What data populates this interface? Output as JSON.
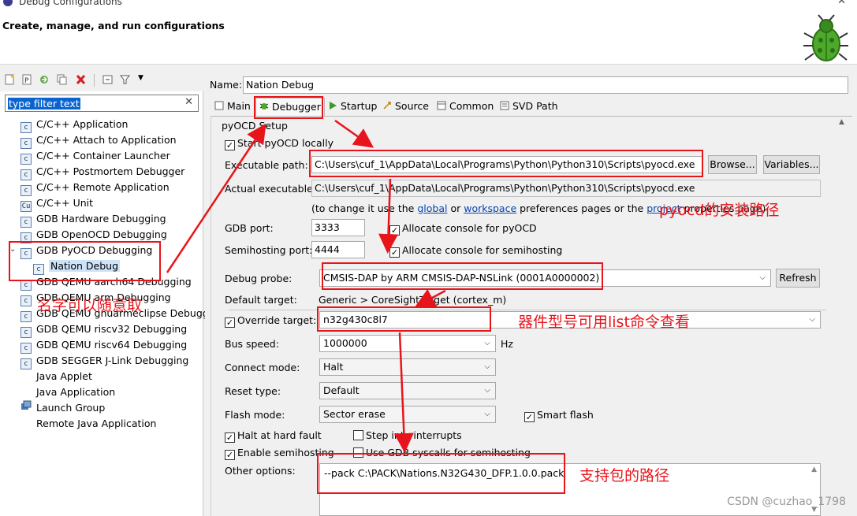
{
  "window": {
    "title": "Debug Configurations"
  },
  "header": {
    "heading": "Create, manage, and run configurations"
  },
  "left": {
    "filter_placeholder": "type filter text",
    "items": [
      {
        "label": "C/C++ Application",
        "icon": "c-config-icon"
      },
      {
        "label": "C/C++ Attach to Application",
        "icon": "c-config-icon"
      },
      {
        "label": "C/C++ Container Launcher",
        "icon": "c-config-icon"
      },
      {
        "label": "C/C++ Postmortem Debugger",
        "icon": "c-config-icon"
      },
      {
        "label": "C/C++ Remote Application",
        "icon": "c-config-icon"
      },
      {
        "label": "C/C++ Unit",
        "icon": "c-unit-icon"
      },
      {
        "label": "GDB Hardware Debugging",
        "icon": "c-config-icon"
      },
      {
        "label": "GDB OpenOCD Debugging",
        "icon": "c-config-icon"
      },
      {
        "label": "GDB PyOCD Debugging",
        "icon": "c-config-icon"
      },
      {
        "label": "Nation Debug",
        "icon": "c-config-icon"
      },
      {
        "label": "GDB QEMU aarch64 Debugging",
        "icon": "c-config-icon"
      },
      {
        "label": "GDB QEMU arm Debugging",
        "icon": "c-config-icon"
      },
      {
        "label": "GDB QEMU gnuarmeclipse Debugg",
        "icon": "c-config-icon"
      },
      {
        "label": "GDB QEMU riscv32 Debugging",
        "icon": "c-config-icon"
      },
      {
        "label": "GDB QEMU riscv64 Debugging",
        "icon": "c-config-icon"
      },
      {
        "label": "GDB SEGGER J-Link Debugging",
        "icon": "c-config-icon"
      },
      {
        "label": "Java Applet",
        "icon": ""
      },
      {
        "label": "Java Application",
        "icon": ""
      },
      {
        "label": "Launch Group",
        "icon": "launch-group-icon"
      },
      {
        "label": "Remote Java Application",
        "icon": ""
      }
    ]
  },
  "main": {
    "name_label": "Name:",
    "name_value": "Nation Debug",
    "tabs": [
      {
        "label": "Main"
      },
      {
        "label": "Debugger"
      },
      {
        "label": "Startup"
      },
      {
        "label": "Source"
      },
      {
        "label": "Common"
      },
      {
        "label": "SVD Path"
      }
    ],
    "group_title": "pyOCD Setup",
    "start_locally": "Start pyOCD locally",
    "exec_label": "Executable path:",
    "exec_value": "C:\\Users\\cuf_1\\AppData\\Local\\Programs\\Python\\Python310\\Scripts\\pyocd.exe",
    "browse": "Browse...",
    "variables": "Variables...",
    "actual_label": "Actual executable:",
    "actual_value": "C:\\Users\\cuf_1\\AppData\\Local\\Programs\\Python\\Python310\\Scripts\\pyocd.exe",
    "hint_prefix": "(to change it use the",
    "hint_global": "global",
    "hint_or": "or",
    "hint_workspace": "workspace",
    "hint_mid": "preferences pages or the",
    "hint_project": "project",
    "hint_suffix": "properties page)",
    "gdb_port_label": "GDB port:",
    "gdb_port": "3333",
    "alloc_pyocd": "Allocate console for pyOCD",
    "semi_port_label": "Semihosting port:",
    "semi_port": "4444",
    "alloc_semi": "Allocate console for semihosting",
    "probe_label": "Debug probe:",
    "probe_value": "CMSIS-DAP by ARM CMSIS-DAP-NSLink (0001A0000002)",
    "refresh": "Refresh",
    "default_target_label": "Default target:",
    "default_target_value": "Generic > CoreSightTarget (cortex_m)",
    "override_label": "Override target:",
    "override_value": "n32g430c8l7",
    "bus_label": "Bus speed:",
    "bus_value": "1000000",
    "bus_unit": "Hz",
    "connect_label": "Connect mode:",
    "connect_value": "Halt",
    "reset_label": "Reset type:",
    "reset_value": "Default",
    "flash_label": "Flash mode:",
    "flash_value": "Sector erase",
    "smart_flash": "Smart flash",
    "halt_fault": "Halt at hard fault",
    "step_into": "Step into interrupts",
    "enable_semi": "Enable semihosting",
    "use_gdb_syscalls": "Use GDB syscalls for semihosting",
    "other_label": "Other options:",
    "other_value": "--pack C:\\PACK\\Nations.N32G430_DFP.1.0.0.pack"
  },
  "annotations": {
    "install_path": "pyocd的安装路径",
    "name_any": "名字可以随意取",
    "device_model": "器件型号可用list命令查看",
    "pack_path": "支持包的路径"
  },
  "watermark": "CSDN @cuzhao_1798",
  "colors": {
    "annotation": "#e8141b",
    "selection": "#0a64d0",
    "link": "#0645ad"
  }
}
